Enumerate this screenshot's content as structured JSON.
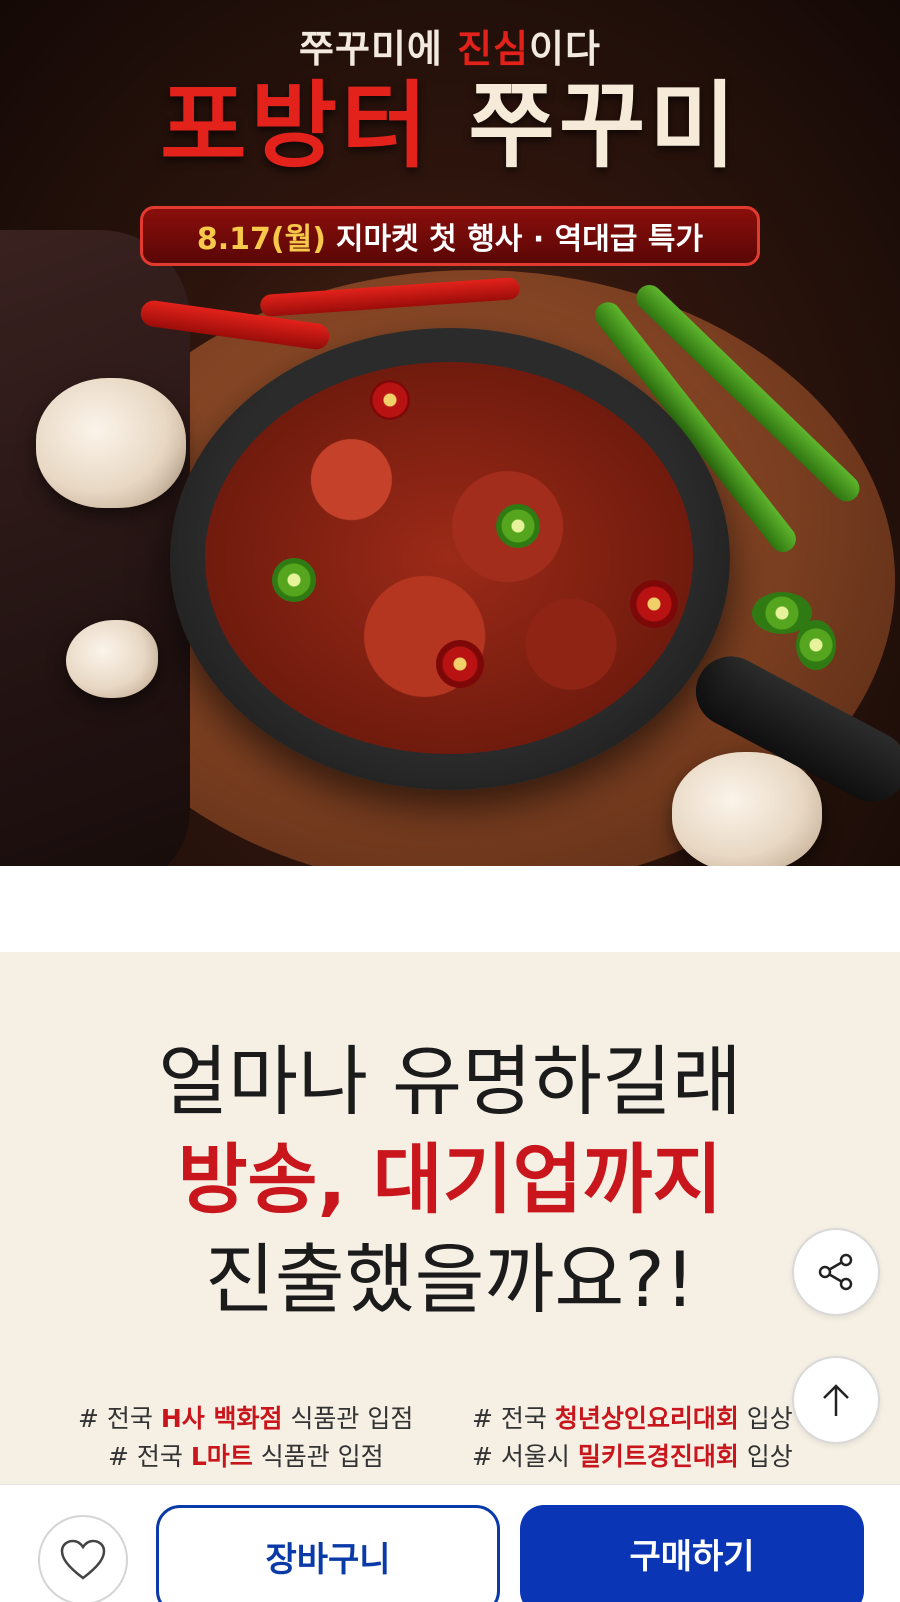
{
  "hero": {
    "tagline_before": "쭈꾸미에 ",
    "tagline_accent": "진심",
    "tagline_after": "이다",
    "brand_red": "포방터",
    "brand_cream": "쭈꾸미",
    "event_date": "8.17(월)",
    "event_text": "지마켓 첫 행사 · 역대급 특가"
  },
  "promo": {
    "line1": "얼마나 유명하길래",
    "line2": "방송, 대기업까지",
    "line3": "진출했을까요?!",
    "tags_left": [
      {
        "prefix": "# 전국 ",
        "highlight": "H사 백화점",
        "suffix": " 식품관 입점"
      },
      {
        "prefix": "# 전국 ",
        "highlight": "L마트",
        "suffix": " 식품관 입점"
      }
    ],
    "tags_right": [
      {
        "prefix": "# 전국 ",
        "highlight": "청년상인요리대회",
        "suffix": " 입상"
      },
      {
        "prefix": "# 서울시 ",
        "highlight": "밀키트경진대회",
        "suffix": " 입상"
      }
    ]
  },
  "floating": {
    "share_icon": "share-icon",
    "top_icon": "arrow-up-icon"
  },
  "bottom_bar": {
    "wishlist_icon": "heart-icon",
    "cart_label": "장바구니",
    "buy_label": "구매하기"
  },
  "colors": {
    "accent_red": "#c9151c",
    "primary_blue": "#0a36b5",
    "promo_bg": "#f5efe4"
  }
}
